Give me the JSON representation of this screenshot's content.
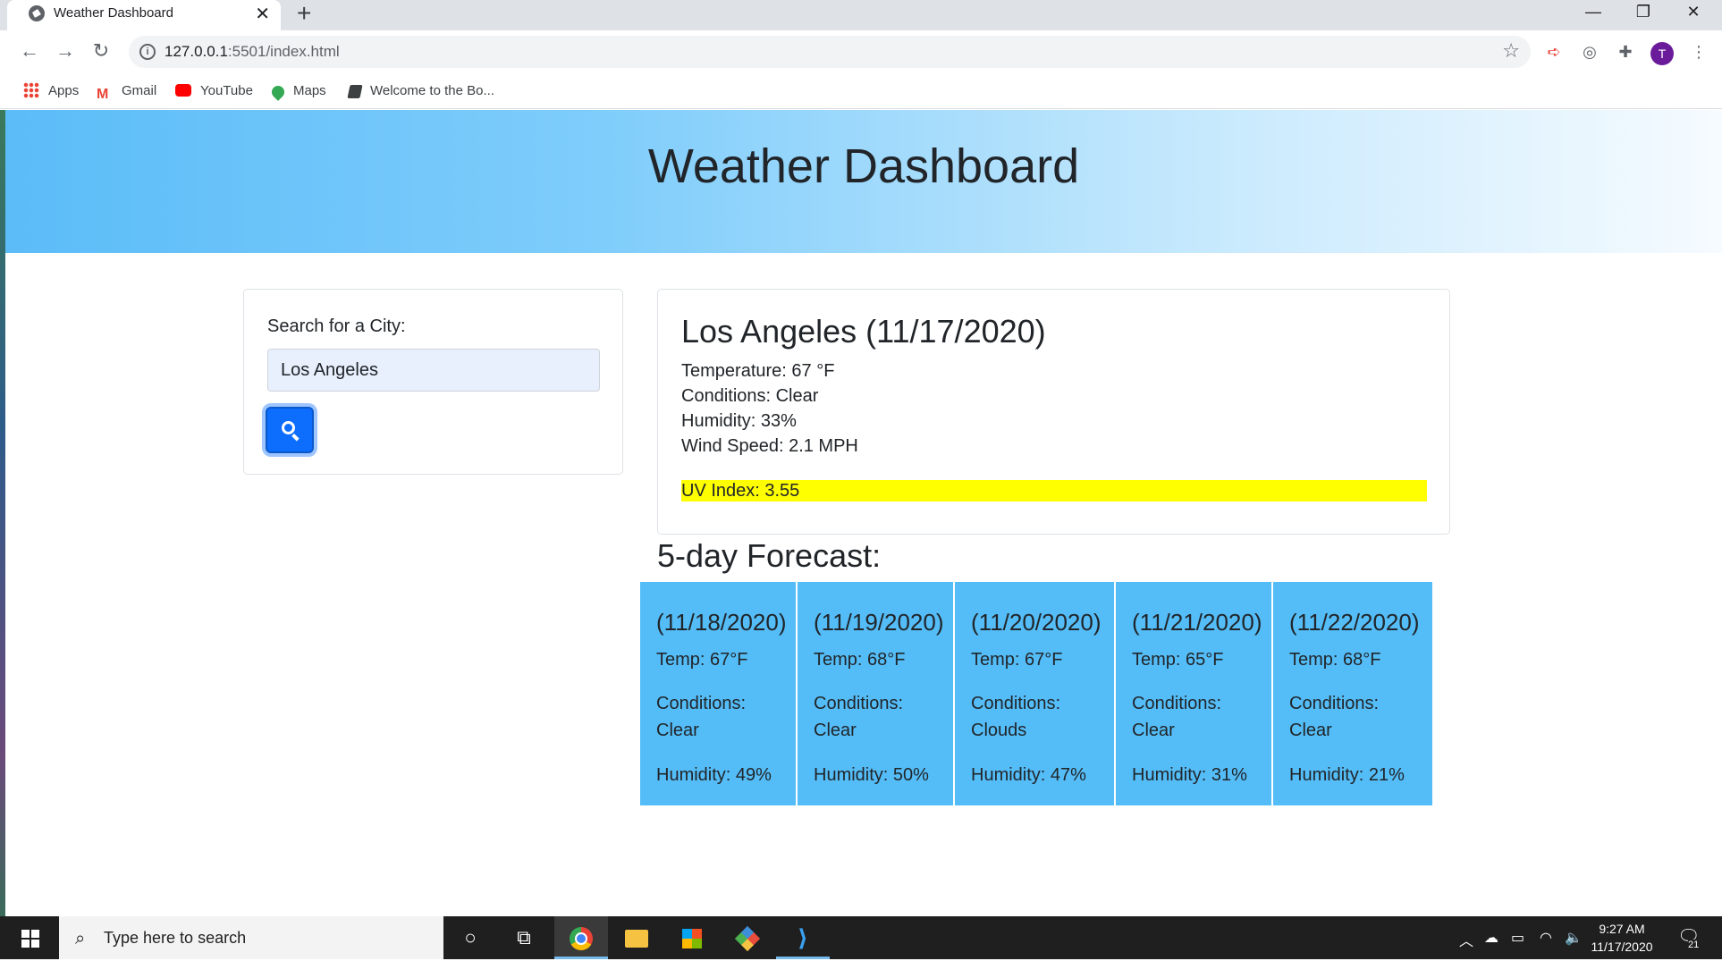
{
  "browser": {
    "tab_title": "Weather Dashboard",
    "url_host": "127.0.0.1",
    "url_path": ":5501/index.html",
    "profile_initial": "T",
    "bookmarks": [
      "Apps",
      "Gmail",
      "YouTube",
      "Maps",
      "Welcome to the Bo..."
    ]
  },
  "header": {
    "title": "Weather Dashboard"
  },
  "search": {
    "label": "Search for a City:",
    "value": "Los Angeles"
  },
  "current": {
    "city_date": "Los Angeles (11/17/2020)",
    "temperature": "Temperature: 67 °F",
    "conditions": "Conditions: Clear",
    "humidity": "Humidity: 33%",
    "wind": "Wind Speed: 2.1 MPH",
    "uv": "UV Index: 3.55",
    "uv_color": "#ffff00"
  },
  "forecast": {
    "title": "5-day Forecast:",
    "card_color": "#54bdf8",
    "days": [
      {
        "date": "(11/18/2020)",
        "temp": "Temp: 67°F",
        "cond_label": "Conditions:",
        "cond_value": "Clear",
        "humidity": "Humidity: 49%"
      },
      {
        "date": "(11/19/2020)",
        "temp": "Temp: 68°F",
        "cond_label": "Conditions:",
        "cond_value": "Clear",
        "humidity": "Humidity: 50%"
      },
      {
        "date": "(11/20/2020)",
        "temp": "Temp: 67°F",
        "cond_label": "Conditions:",
        "cond_value": "Clouds",
        "humidity": "Humidity: 47%"
      },
      {
        "date": "(11/21/2020)",
        "temp": "Temp: 65°F",
        "cond_label": "Conditions:",
        "cond_value": "Clear",
        "humidity": "Humidity: 31%"
      },
      {
        "date": "(11/22/2020)",
        "temp": "Temp: 68°F",
        "cond_label": "Conditions:",
        "cond_value": "Clear",
        "humidity": "Humidity: 21%"
      }
    ]
  },
  "taskbar": {
    "search_placeholder": "Type here to search",
    "time": "9:27 AM",
    "date": "11/17/2020",
    "notifications": "21"
  }
}
